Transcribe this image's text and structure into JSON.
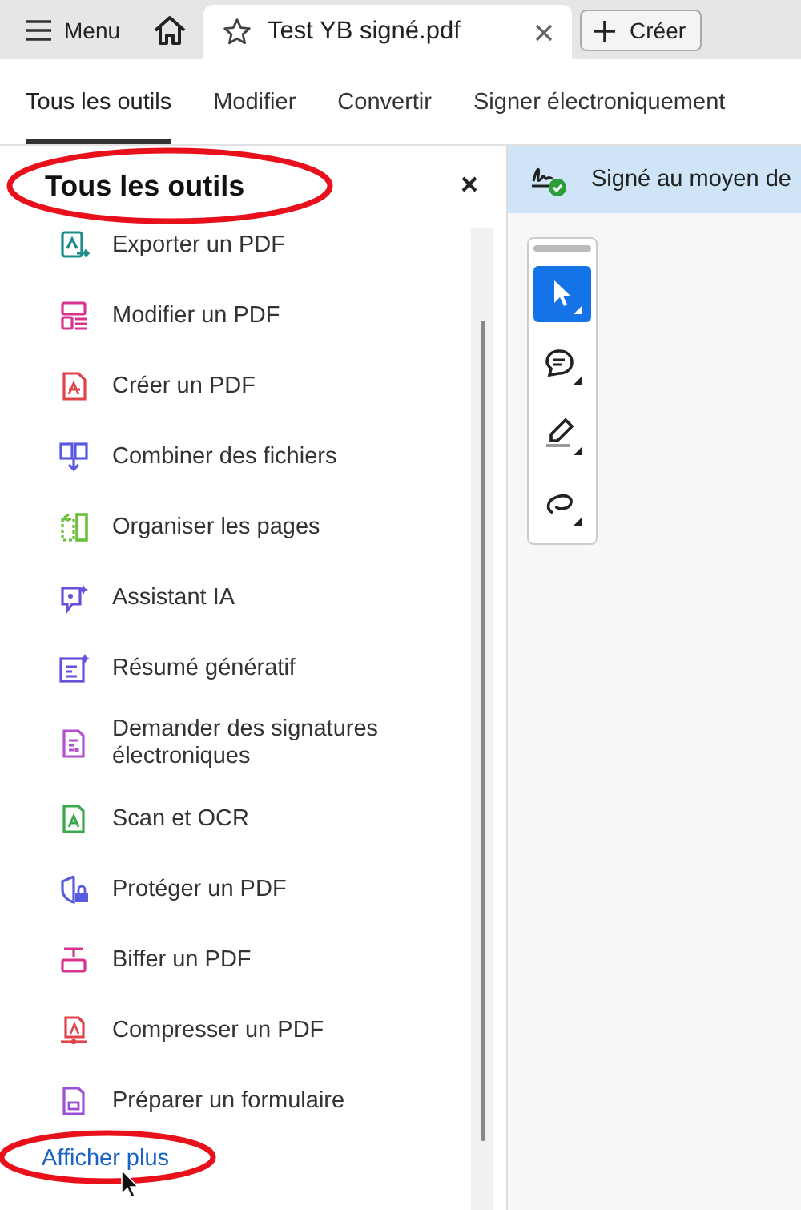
{
  "top_bar": {
    "menu": "Menu",
    "tab": {
      "title": "Test YB signé.pdf",
      "selected": true
    },
    "create": "Créer"
  },
  "nav_tabs": [
    {
      "label": "Tous les outils",
      "selected": true
    },
    {
      "label": "Modifier",
      "selected": false
    },
    {
      "label": "Convertir",
      "selected": false
    },
    {
      "label": "Signer électroniquement",
      "selected": false
    }
  ],
  "tools_panel": {
    "title": "Tous les outils",
    "items": [
      {
        "label": "Exporter un PDF",
        "color": "#1a8c8c"
      },
      {
        "label": "Modifier un PDF",
        "color": "#d6348f"
      },
      {
        "label": "Créer un PDF",
        "color": "#e0444b"
      },
      {
        "label": "Combiner des fichiers",
        "color": "#5a5ae0"
      },
      {
        "label": "Organiser les pages",
        "color": "#6bbf3a"
      },
      {
        "label": "Assistant IA",
        "color": "#6b4fd8"
      },
      {
        "label": "Résumé génératif",
        "color": "#6b4fd8"
      },
      {
        "label": "Demander des signatures électroniques",
        "color": "#b44fd0"
      },
      {
        "label": "Scan et OCR",
        "color": "#3aa84a"
      },
      {
        "label": "Protéger un PDF",
        "color": "#5a5ae0"
      },
      {
        "label": "Biffer un PDF",
        "color": "#d6348f"
      },
      {
        "label": "Compresser un PDF",
        "color": "#e0444b"
      },
      {
        "label": "Préparer un formulaire",
        "color": "#9a4fd8"
      }
    ],
    "show_more": "Afficher plus"
  },
  "banner": {
    "text": "Signé au moyen de"
  },
  "toolbar": [
    {
      "kind": "select",
      "selected": true
    },
    {
      "kind": "comment",
      "selected": false
    },
    {
      "kind": "draw",
      "selected": false
    },
    {
      "kind": "lasso",
      "selected": false
    }
  ]
}
